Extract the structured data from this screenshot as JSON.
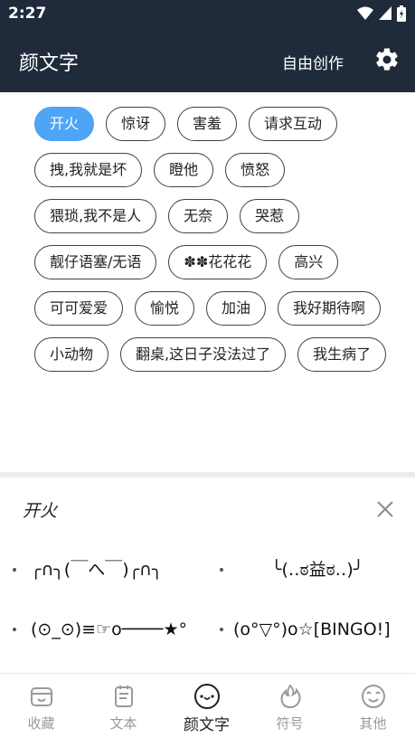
{
  "status_bar": {
    "time": "2:27"
  },
  "app_bar": {
    "title": "颜文字",
    "action_label": "自由创作",
    "settings_icon": "gear-icon"
  },
  "tags": [
    {
      "label": "开火",
      "active": true
    },
    {
      "label": "惊讶",
      "active": false
    },
    {
      "label": "害羞",
      "active": false
    },
    {
      "label": "请求互动",
      "active": false
    },
    {
      "label": "拽,我就是坏",
      "active": false
    },
    {
      "label": "瞪他",
      "active": false
    },
    {
      "label": "愤怒",
      "active": false
    },
    {
      "label": "猥琐,我不是人",
      "active": false
    },
    {
      "label": "无奈",
      "active": false
    },
    {
      "label": "哭惹",
      "active": false
    },
    {
      "label": "靓仔语塞/无语",
      "active": false
    },
    {
      "label": "✽✽花花花",
      "active": false
    },
    {
      "label": "高兴",
      "active": false
    },
    {
      "label": "可可爱爱",
      "active": false
    },
    {
      "label": "愉悦",
      "active": false
    },
    {
      "label": "加油",
      "active": false
    },
    {
      "label": "我好期待啊",
      "active": false
    },
    {
      "label": "小动物",
      "active": false
    },
    {
      "label": "翻桌,这日子没法过了",
      "active": false
    },
    {
      "label": "我生病了",
      "active": false
    }
  ],
  "panel": {
    "title": "开火",
    "close_icon": "close-icon",
    "items": [
      "╭∩╮(￣へ￣)╭∩╮",
      "╰(‥ಠ益ಠ‥)╯",
      "(⊙_⊙)≡☞o────★°",
      "(o°▽°)o☆[BINGO!]"
    ]
  },
  "bottom_nav": [
    {
      "label": "收藏",
      "icon": "favorites-box-icon",
      "active": false
    },
    {
      "label": "文本",
      "icon": "notepad-icon",
      "active": false
    },
    {
      "label": "颜文字",
      "icon": "kaomoji-face-icon",
      "active": true
    },
    {
      "label": "符号",
      "icon": "flame-icon",
      "active": false
    },
    {
      "label": "其他",
      "icon": "smiley-icon",
      "active": false
    }
  ],
  "colors": {
    "header_bg": "#1f2a3a",
    "accent": "#4ea4f5",
    "inactive_nav": "#9a9a9a"
  }
}
